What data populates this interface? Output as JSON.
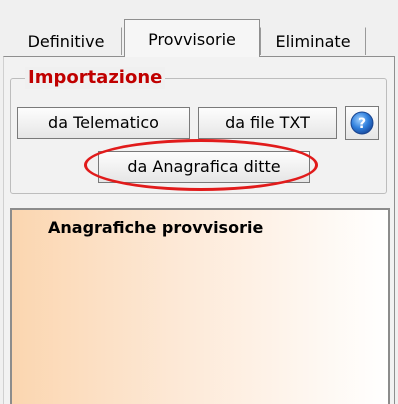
{
  "tabs": [
    {
      "label": "Definitive",
      "active": false
    },
    {
      "label": "Provvisorie",
      "active": true
    },
    {
      "label": "Eliminate",
      "active": false
    }
  ],
  "importazione": {
    "title": "Importazione",
    "title_color": "#c00000",
    "buttons": {
      "telematico": "da Telematico",
      "file_txt": "da file TXT",
      "anagrafica": "da Anagrafica ditte"
    },
    "help_icon": "question-circle-icon",
    "highlight_color": "#e11b1b"
  },
  "list": {
    "title": "Anagrafiche provvisorie"
  }
}
